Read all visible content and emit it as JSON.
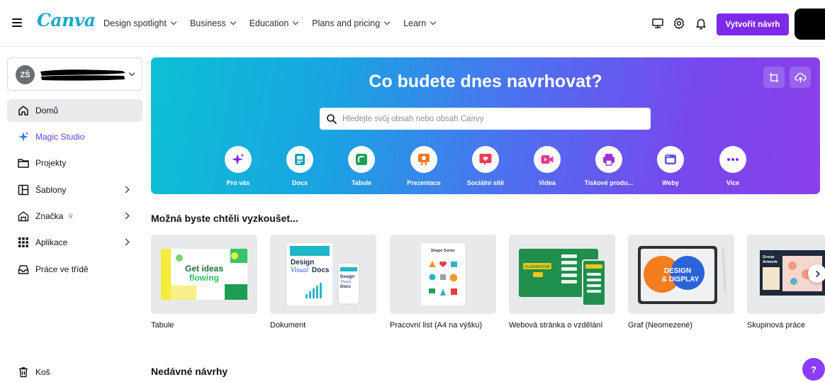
{
  "header": {
    "logo": "Canva",
    "nav": [
      {
        "label": "Design spotlight"
      },
      {
        "label": "Business"
      },
      {
        "label": "Education"
      },
      {
        "label": "Plans and pricing"
      },
      {
        "label": "Learn"
      }
    ],
    "create_button": "Vytvořit návrh"
  },
  "sidebar": {
    "account_initials": "ZŠ",
    "items": [
      {
        "label": "Domů",
        "icon": "home-icon",
        "active": true
      },
      {
        "label": "Magic Studio",
        "icon": "sparkle-icon"
      },
      {
        "label": "Projekty",
        "icon": "folder-icon"
      },
      {
        "label": "Šablony",
        "icon": "templates-icon"
      },
      {
        "label": "Značka",
        "icon": "brand-icon"
      },
      {
        "label": "Aplikace",
        "icon": "apps-grid-icon"
      },
      {
        "label": "Práce ve třídě",
        "icon": "inbox-icon"
      }
    ],
    "trash_label": "Koš"
  },
  "hero": {
    "title": "Co budete dnes navrhovat?",
    "search_placeholder": "Hledejte svůj obsah nebo obsah Canvy",
    "categories": [
      {
        "label": "Pro vás",
        "icon": "sparkle-icon",
        "color": "#7d2ae8"
      },
      {
        "label": "Docs",
        "icon": "doc-icon",
        "color": "#13a3b5"
      },
      {
        "label": "Tabule",
        "icon": "whiteboard-icon",
        "color": "#1b9e5a"
      },
      {
        "label": "Prezentace",
        "icon": "presentation-icon",
        "color": "#f4781f"
      },
      {
        "label": "Sociální sítě",
        "icon": "heart-chat-icon",
        "color": "#ec3d52"
      },
      {
        "label": "Videa",
        "icon": "video-icon",
        "color": "#e93a8f"
      },
      {
        "label": "Tiskové produ...",
        "icon": "print-icon",
        "color": "#9b33d9"
      },
      {
        "label": "Weby",
        "icon": "web-icon",
        "color": "#6556e8"
      },
      {
        "label": "Více",
        "icon": "more-icon",
        "color": "#7d2ae8"
      }
    ]
  },
  "suggestions": {
    "title": "Možná byste chtěli vyzkoušet...",
    "cards": [
      {
        "label": "Tabule",
        "thumb_text": "Get ideas flowing"
      },
      {
        "label": "Dokument",
        "thumb_text": "Design Visual Docs"
      },
      {
        "label": "Pracovní list (A4 na výšku)",
        "thumb_text": "Shape Sorter"
      },
      {
        "label": "Webová stránka o vzdělání",
        "thumb_text": "CLASSROOM"
      },
      {
        "label": "Graf (Neomezené)",
        "thumb_text": "DESIGN & DISPLAY"
      },
      {
        "label": "Skupinová práce",
        "thumb_text": "Group Artwork"
      }
    ]
  },
  "recent": {
    "title": "Nedávné návrhy"
  },
  "help_label": "?"
}
